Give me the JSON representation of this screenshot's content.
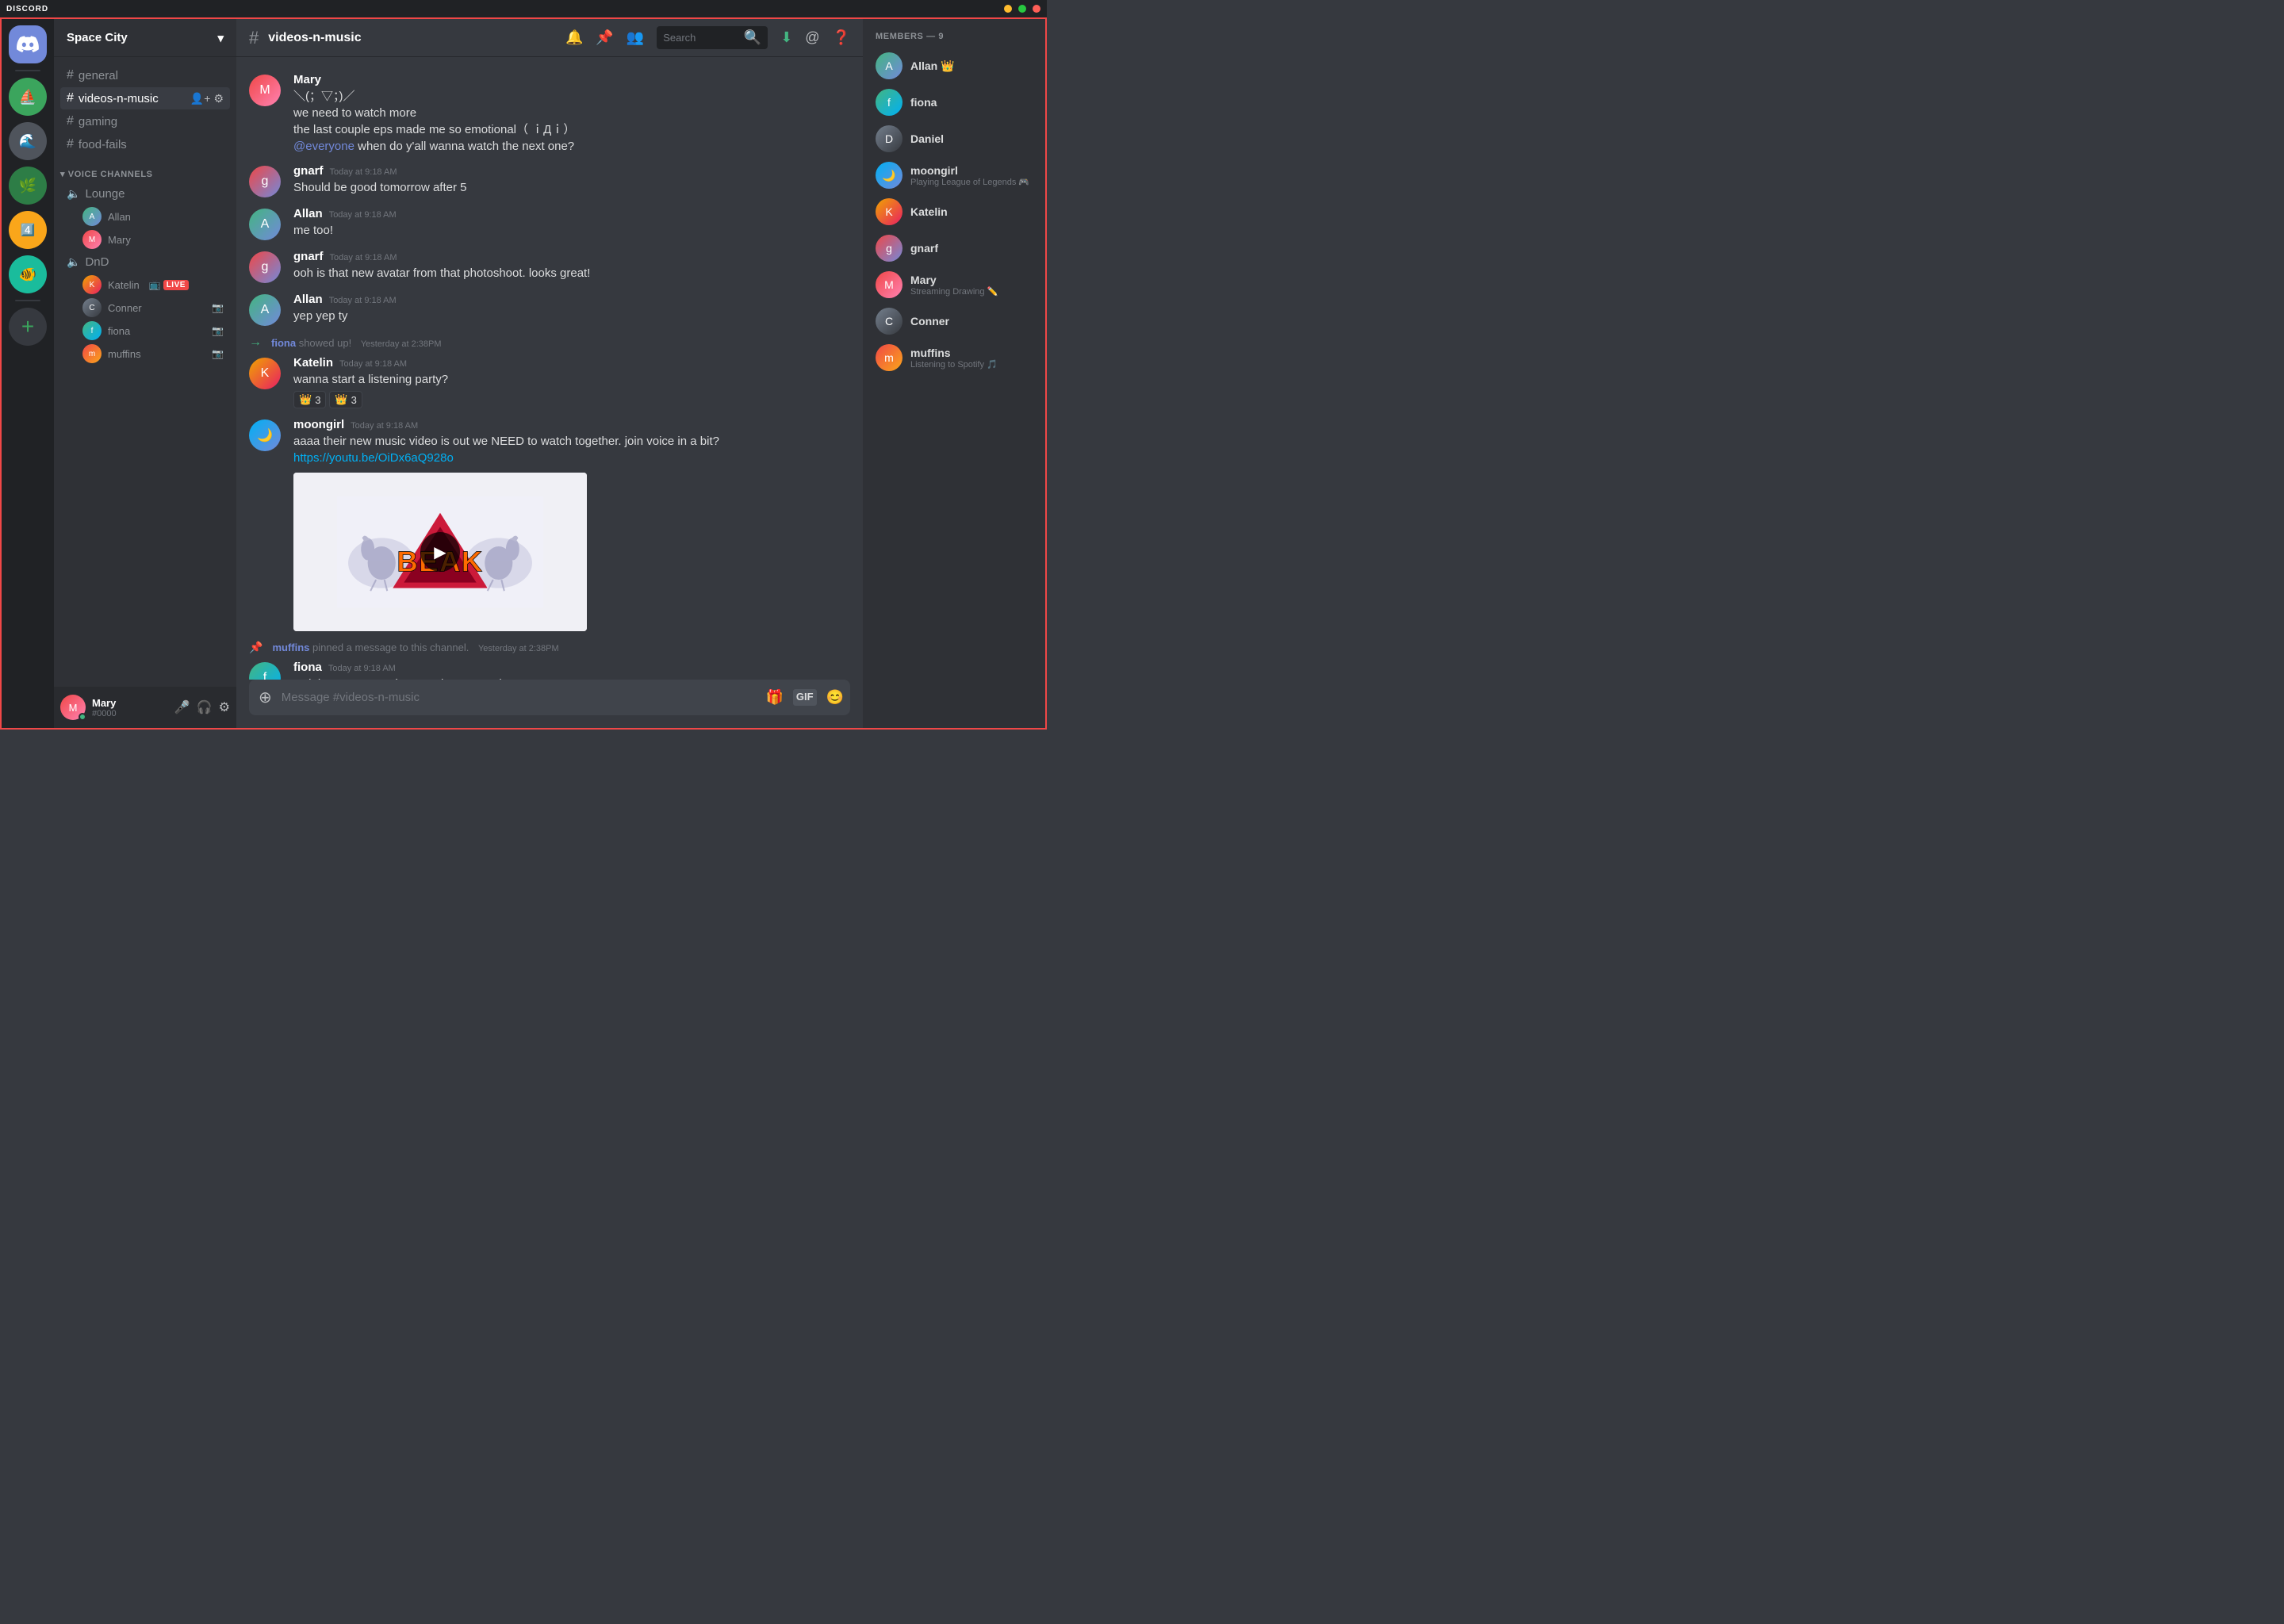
{
  "titlebar": {
    "logo": "DISCORD",
    "controls": [
      "minimize",
      "maximize",
      "close"
    ]
  },
  "servers": [
    {
      "id": "discord",
      "icon": "💬",
      "color": "#7289da",
      "bg": "#7289da"
    },
    {
      "id": "s1",
      "emoji": "⛵",
      "bg": "#3ba55d"
    },
    {
      "id": "s2",
      "emoji": "🌊",
      "bg": "#4f545c"
    },
    {
      "id": "s3",
      "emoji": "🌿",
      "bg": "#2d7d46"
    },
    {
      "id": "s4",
      "emoji": "4️⃣",
      "bg": "#faa61a"
    },
    {
      "id": "s5",
      "emoji": "🐠",
      "bg": "#1abc9c"
    },
    {
      "id": "add",
      "icon": "+",
      "bg": "#3ba55d"
    }
  ],
  "sidebar": {
    "server_name": "Space City",
    "channels": [
      {
        "type": "text",
        "name": "general",
        "id": "general"
      },
      {
        "type": "text",
        "name": "videos-n-music",
        "id": "videos-n-music",
        "active": true
      },
      {
        "type": "text",
        "name": "gaming",
        "id": "gaming"
      },
      {
        "type": "text",
        "name": "food-fails",
        "id": "food-fails"
      }
    ],
    "voice_category": "VOICE CHANNELS",
    "voice_channels": [
      {
        "name": "Lounge",
        "users": [
          {
            "name": "Allan",
            "av_class": "av-allan"
          },
          {
            "name": "Mary",
            "av_class": "av-mary2"
          }
        ]
      },
      {
        "name": "DnD",
        "users": [
          {
            "name": "Katelin",
            "av_class": "av-katelin",
            "live": true
          },
          {
            "name": "Conner",
            "av_class": "av-conner"
          },
          {
            "name": "fiona",
            "av_class": "av-fiona"
          },
          {
            "name": "muffins",
            "av_class": "av-muffins"
          }
        ]
      }
    ]
  },
  "user_area": {
    "name": "Mary",
    "discriminator": "#0000"
  },
  "header": {
    "channel_name": "videos-n-music",
    "search_placeholder": "Search"
  },
  "messages": [
    {
      "id": "msg1",
      "author": "Mary",
      "author_class": "av-mary2",
      "lines": [
        "＼(；▽；)／",
        "we need to watch more",
        "the last couple eps made me so emotional（ ｉДｉ）"
      ],
      "continued": "@everyone when do y'all wanna watch the next one?",
      "has_mention": true,
      "mention_text": "@everyone"
    },
    {
      "id": "msg2",
      "author": "gnarf",
      "author_class": "av-gnarf",
      "timestamp": "Today at 9:18 AM",
      "text": "Should be good tomorrow after 5"
    },
    {
      "id": "msg3",
      "author": "Allan",
      "author_class": "av-allan",
      "timestamp": "Today at 9:18 AM",
      "text": "me too!"
    },
    {
      "id": "msg4",
      "author": "gnarf",
      "author_class": "av-gnarf",
      "timestamp": "Today at 9:18 AM",
      "text": "ooh is that new avatar from that photoshoot. looks great!"
    },
    {
      "id": "msg5",
      "author": "Allan",
      "author_class": "av-allan",
      "timestamp": "Today at 9:18 AM",
      "text": "yep yep ty"
    },
    {
      "id": "sys1",
      "type": "system",
      "text": "fiona",
      "action": "showed up!",
      "timestamp": "Yesterday at 2:38PM"
    },
    {
      "id": "msg6",
      "author": "Katelin",
      "author_class": "av-katelin",
      "timestamp": "Today at 9:18 AM",
      "text": "wanna start a listening party?",
      "reactions": [
        {
          "emoji": "👑",
          "count": "3"
        },
        {
          "emoji": "👑",
          "count": "3"
        }
      ]
    },
    {
      "id": "msg7",
      "author": "moongirl",
      "author_class": "av-moongirl",
      "timestamp": "Today at 9:18 AM",
      "text": "aaaa their new music video is out we NEED to watch together. join voice in a bit?",
      "link": "https://youtu.be/OiDx6aQ928o",
      "has_video": true
    },
    {
      "id": "sys2",
      "type": "pin",
      "text": "muffins",
      "action": "pinned a message to this channel.",
      "timestamp": "Yesterday at 2:38PM"
    },
    {
      "id": "msg8",
      "author": "fiona",
      "author_class": "av-fiona",
      "timestamp": "Today at 9:18 AM",
      "text": "wait have you see the new dance practice one??"
    }
  ],
  "members": {
    "header": "MEMBERS — 9",
    "list": [
      {
        "name": "Allan",
        "av_class": "av-allan",
        "crown": true
      },
      {
        "name": "fiona",
        "av_class": "av-fiona"
      },
      {
        "name": "Daniel",
        "av_class": "av-conner"
      },
      {
        "name": "moongirl",
        "av_class": "av-moongirl",
        "status": "Playing League of Legends"
      },
      {
        "name": "Katelin",
        "av_class": "av-katelin"
      },
      {
        "name": "gnarf",
        "av_class": "av-gnarf"
      },
      {
        "name": "Mary",
        "av_class": "av-mary2",
        "status": "Streaming Drawing ✏️"
      },
      {
        "name": "Conner",
        "av_class": "av-conner"
      },
      {
        "name": "muffins",
        "av_class": "av-muffins",
        "status": "Listening to Spotify 🎵"
      }
    ]
  },
  "input": {
    "placeholder": "Message #videos-n-music"
  }
}
